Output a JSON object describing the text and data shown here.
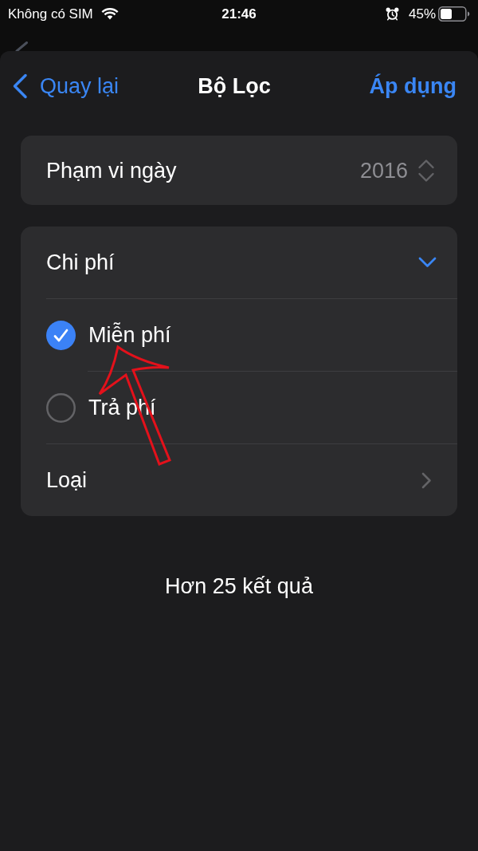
{
  "status_bar": {
    "carrier": "Không có SIM",
    "time": "21:46",
    "battery": "45%"
  },
  "nav": {
    "back_label": "Quay lại",
    "title": "Bộ Lọc",
    "action": "Áp dụng"
  },
  "date_range": {
    "label": "Phạm vi ngày",
    "value": "2016"
  },
  "filters": {
    "cost": {
      "label": "Chi phí",
      "expanded": true,
      "options": [
        {
          "label": "Miễn phí",
          "selected": true
        },
        {
          "label": "Trả phí",
          "selected": false
        }
      ]
    },
    "type": {
      "label": "Loại"
    }
  },
  "result_count": "Hơn 25 kết quả"
}
